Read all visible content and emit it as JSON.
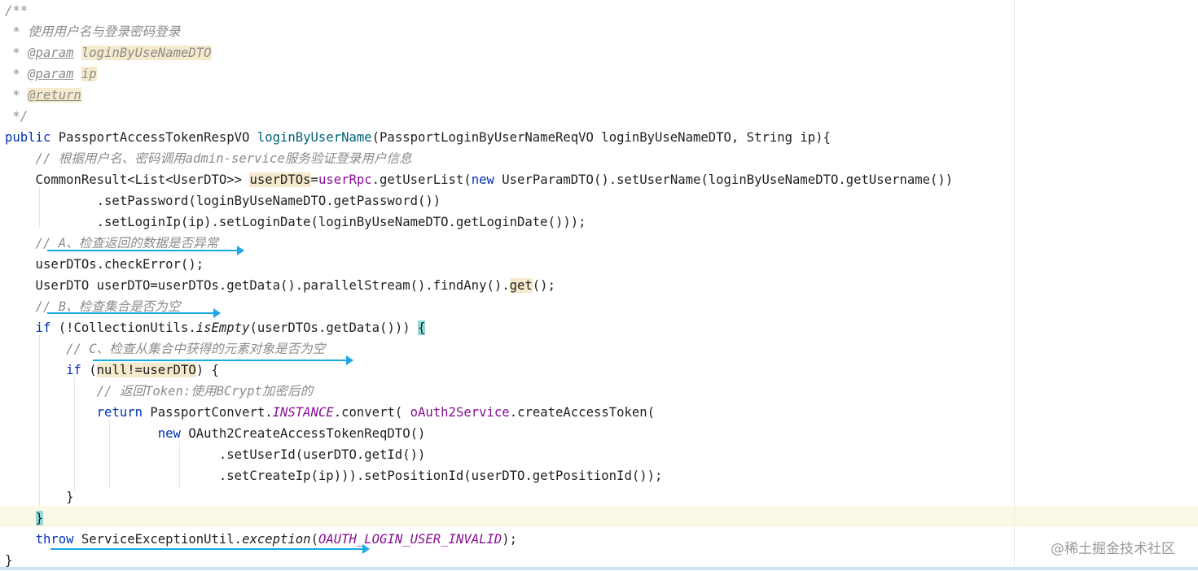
{
  "editor": {
    "lines": [
      {
        "id": "l01",
        "segments": [
          {
            "t": "/**",
            "c": "cmt"
          }
        ]
      },
      {
        "id": "l02",
        "segments": [
          {
            "t": " * 使用用户名与登录密码登录",
            "c": "cmt"
          }
        ]
      },
      {
        "id": "l03",
        "segments": [
          {
            "t": " * ",
            "c": "cmt"
          },
          {
            "t": "@param",
            "c": "doctag"
          },
          {
            "t": " ",
            "c": "cmt"
          },
          {
            "t": "loginByUseNameDTO",
            "c": "cmt hl"
          }
        ]
      },
      {
        "id": "l04",
        "segments": [
          {
            "t": " * ",
            "c": "cmt"
          },
          {
            "t": "@param",
            "c": "doctag"
          },
          {
            "t": " ",
            "c": "cmt"
          },
          {
            "t": "ip",
            "c": "cmt hl"
          }
        ]
      },
      {
        "id": "l05",
        "segments": [
          {
            "t": " * ",
            "c": "cmt"
          },
          {
            "t": "@return",
            "c": "doctag hl"
          }
        ]
      },
      {
        "id": "l06",
        "segments": [
          {
            "t": " */",
            "c": "cmt"
          }
        ]
      },
      {
        "id": "l07",
        "segments": [
          {
            "t": "public",
            "c": "kw"
          },
          {
            "t": " PassportAccessTokenRespVO "
          },
          {
            "t": "loginByUserName",
            "c": "mth"
          },
          {
            "t": "(PassportLoginByUserNameReqVO loginByUseNameDTO, String ip){"
          }
        ]
      },
      {
        "id": "l08",
        "segments": [
          {
            "t": "    // 根据用户名、密码调用admin-service服务验证登录用户信息",
            "c": "cmt"
          }
        ]
      },
      {
        "id": "l09",
        "segments": [
          {
            "t": "    CommonResult<List<UserDTO>> "
          },
          {
            "t": "userDTOs",
            "c": "hl"
          },
          {
            "t": "="
          },
          {
            "t": "userRpc",
            "c": "fld"
          },
          {
            "t": ".getUserList("
          },
          {
            "t": "new",
            "c": "kw"
          },
          {
            "t": " UserParamDTO().setUserName(loginByUseNameDTO.getUsername())"
          }
        ]
      },
      {
        "id": "l10",
        "segments": [
          {
            "t": "            .setPassword(loginByUseNameDTO.getPassword())"
          }
        ]
      },
      {
        "id": "l11",
        "segments": [
          {
            "t": "            .setLoginIp(ip).setLoginDate(loginByUseNameDTO.getLoginDate()));"
          }
        ]
      },
      {
        "id": "l12",
        "segments": [
          {
            "t": "    // A、检查返回的数据是否异常",
            "c": "cmt"
          }
        ]
      },
      {
        "id": "l13",
        "segments": [
          {
            "t": "    userDTOs.checkError();"
          }
        ]
      },
      {
        "id": "l14",
        "segments": [
          {
            "t": "    UserDTO userDTO=userDTOs.getData().parallelStream().findAny()."
          },
          {
            "t": "get",
            "c": "hl"
          },
          {
            "t": "();"
          }
        ]
      },
      {
        "id": "l15",
        "segments": [
          {
            "t": "    // B、检查集合是否为空",
            "c": "cmt"
          }
        ]
      },
      {
        "id": "l16",
        "segments": [
          {
            "t": "    "
          },
          {
            "t": "if",
            "c": "kw"
          },
          {
            "t": " (!CollectionUtils."
          },
          {
            "t": "isEmpty",
            "c": "it"
          },
          {
            "t": "(userDTOs.getData())) "
          },
          {
            "t": "{",
            "c": "brace-hl"
          }
        ]
      },
      {
        "id": "l17",
        "segments": [
          {
            "t": "        // C、检查从集合中获得的元素对象是否为空",
            "c": "cmt"
          }
        ]
      },
      {
        "id": "l18",
        "segments": [
          {
            "t": "        "
          },
          {
            "t": "if",
            "c": "kw"
          },
          {
            "t": " ("
          },
          {
            "t": "null!=userDTO",
            "c": "hl"
          },
          {
            "t": ") {"
          }
        ]
      },
      {
        "id": "l19",
        "segments": [
          {
            "t": "            // 返回Token:使用BCrypt加密后的",
            "c": "cmt"
          }
        ]
      },
      {
        "id": "l20",
        "segments": [
          {
            "t": "            "
          },
          {
            "t": "return",
            "c": "kw"
          },
          {
            "t": " PassportConvert."
          },
          {
            "t": "INSTANCE",
            "c": "fld-it"
          },
          {
            "t": ".convert( "
          },
          {
            "t": "oAuth2Service",
            "c": "fld"
          },
          {
            "t": ".createAccessToken("
          }
        ]
      },
      {
        "id": "l21",
        "segments": [
          {
            "t": "                    "
          },
          {
            "t": "new",
            "c": "kw"
          },
          {
            "t": " OAuth2CreateAccessTokenReqDTO()"
          }
        ]
      },
      {
        "id": "l22",
        "segments": [
          {
            "t": "                            .setUserId(userDTO.getId())"
          }
        ]
      },
      {
        "id": "l23",
        "segments": [
          {
            "t": "                            .setCreateIp(ip))).setPositionId(userDTO.getPositionId());"
          }
        ]
      },
      {
        "id": "l24",
        "segments": [
          {
            "t": "        }"
          }
        ]
      },
      {
        "id": "l25",
        "segments": [
          {
            "t": "    "
          },
          {
            "t": "}",
            "c": "brace-hl"
          }
        ]
      },
      {
        "id": "l26",
        "segments": [
          {
            "t": "    "
          },
          {
            "t": "throw",
            "c": "kw"
          },
          {
            "t": " ServiceExceptionUtil."
          },
          {
            "t": "exception",
            "c": "it"
          },
          {
            "t": "("
          },
          {
            "t": "OAUTH_LOGIN_USER_INVALID",
            "c": "fld-it"
          },
          {
            "t": ");"
          }
        ]
      },
      {
        "id": "l27",
        "segments": [
          {
            "t": "}"
          }
        ]
      }
    ]
  },
  "watermark": {
    "text": "@稀土掘金技术社区"
  },
  "colors": {
    "keyword": "#0033b3",
    "method": "#00627a",
    "field": "#871094",
    "comment": "#8c8c8c",
    "annotation_arrow": "#1aa8e6",
    "identifier_highlight": "#f5eacb",
    "brace_match": "#93d9d9"
  }
}
